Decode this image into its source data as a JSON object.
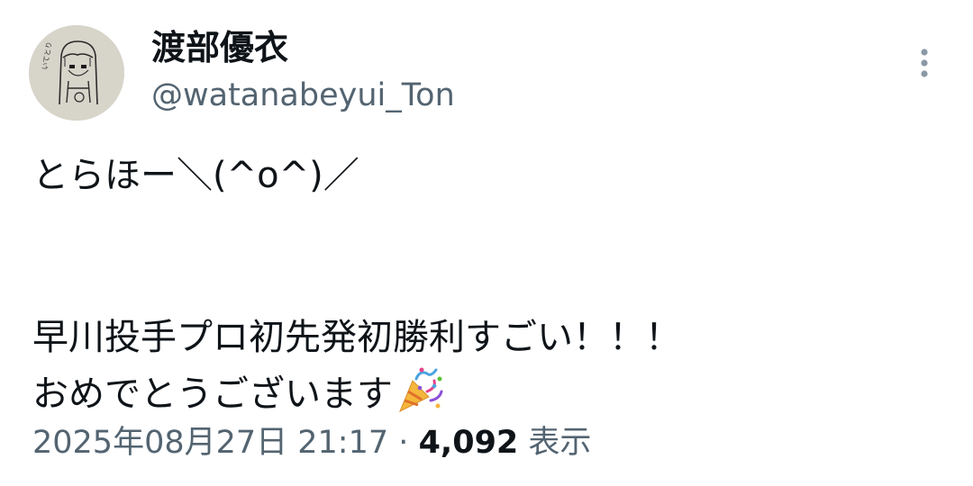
{
  "author": {
    "display_name": "渡部優衣",
    "handle": "@watanabeyui_Ton",
    "avatar_icon": "hand-drawn-girl-avatar"
  },
  "header": {
    "more_icon": "more-vertical-icon"
  },
  "tweet": {
    "lines": [
      "とらほー＼(^o^)／",
      "",
      "早川投手プロ初先発初勝利すごい！！！",
      "おめでとうございます"
    ],
    "emoji_icon": "party-popper-icon"
  },
  "meta": {
    "timestamp": "2025年08月27日 21:17",
    "separator": "·",
    "views_count": "4,092",
    "views_label": "表示"
  },
  "colors": {
    "text_primary": "#0f1419",
    "text_secondary": "#536471",
    "background": "#ffffff"
  }
}
